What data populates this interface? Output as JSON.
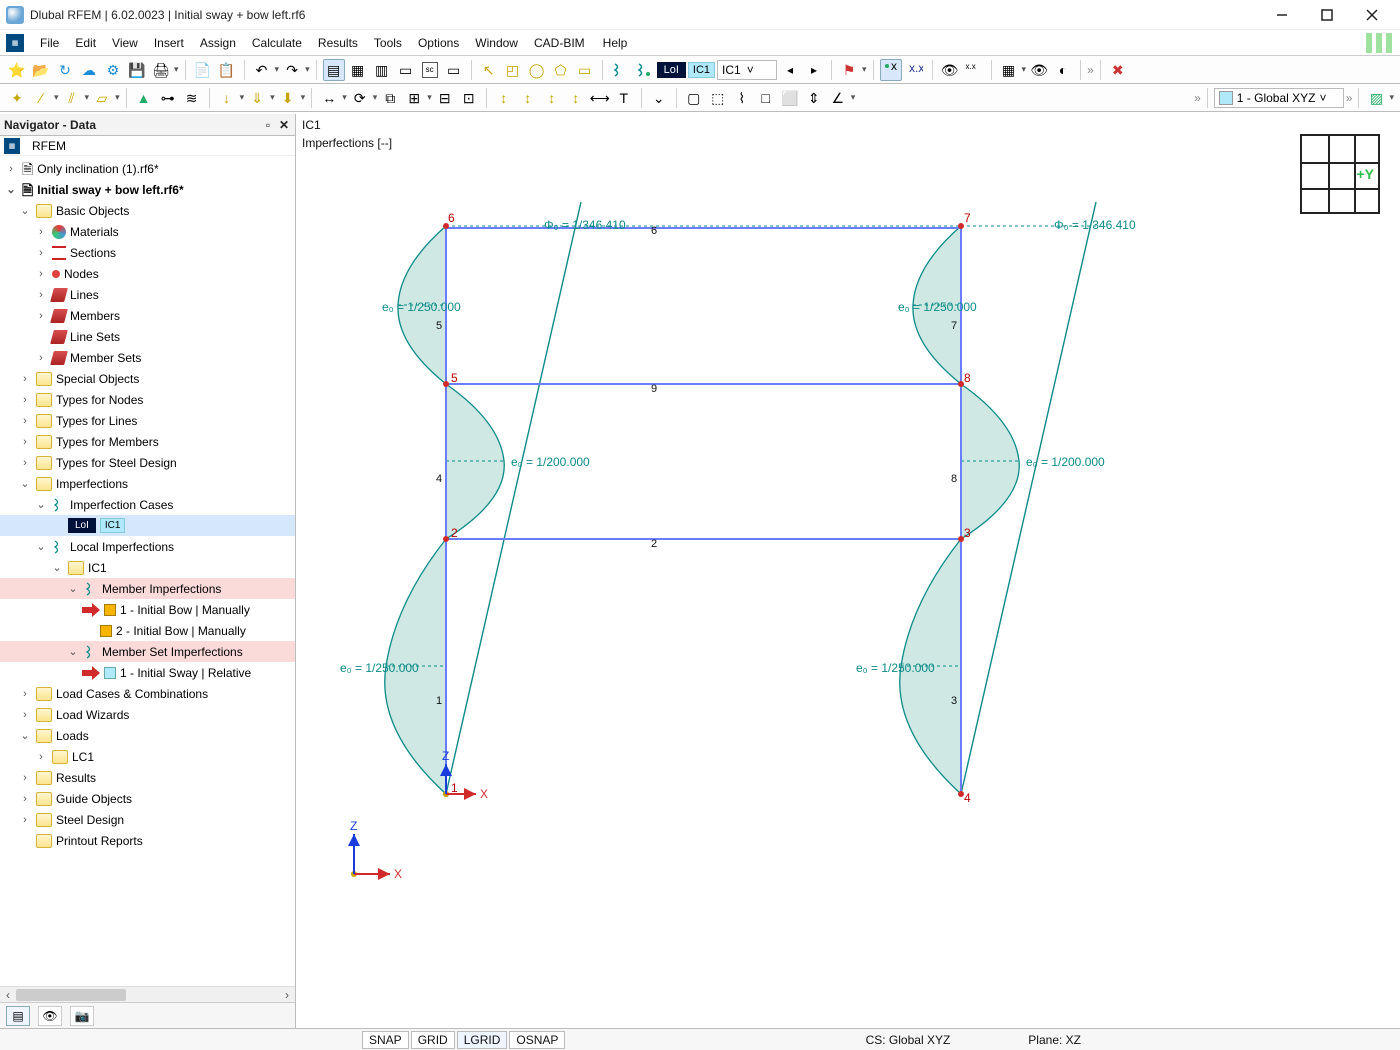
{
  "window": {
    "title": "Dlubal RFEM | 6.02.0023 | Initial sway + bow left.rf6"
  },
  "menu": {
    "items": [
      "File",
      "Edit",
      "View",
      "Insert",
      "Assign",
      "Calculate",
      "Results",
      "Tools",
      "Options",
      "Window",
      "CAD-BIM",
      "Help"
    ]
  },
  "context_labels": {
    "lol": "LoI",
    "ic1": "IC1",
    "global_xyz": "1 - Global XYZ"
  },
  "navigator": {
    "title": "Navigator - Data",
    "app": "RFEM",
    "file1": "Only inclination (1).rf6*",
    "file2": "Initial sway + bow left.rf6*",
    "basic_objects": "Basic Objects",
    "materials": "Materials",
    "sections": "Sections",
    "nodes": "Nodes",
    "lines": "Lines",
    "members": "Members",
    "line_sets": "Line Sets",
    "member_sets": "Member Sets",
    "special_objects": "Special Objects",
    "types_nodes": "Types for Nodes",
    "types_lines": "Types for Lines",
    "types_members": "Types for Members",
    "types_steel": "Types for Steel Design",
    "imperfections": "Imperfections",
    "imp_cases": "Imperfection Cases",
    "lol": "LoI",
    "ic1_sel": "IC1",
    "local_imp": "Local Imperfections",
    "ic1": "IC1",
    "member_imp": "Member Imperfections",
    "mi1": "1 - Initial Bow | Manually",
    "mi2": "2 - Initial Bow | Manually",
    "memberset_imp": "Member Set Imperfections",
    "msi1": "1 - Initial Sway | Relative",
    "lcc": "Load Cases & Combinations",
    "load_wiz": "Load Wizards",
    "loads": "Loads",
    "lc1": "LC1",
    "results": "Results",
    "guide": "Guide Objects",
    "steel": "Steel Design",
    "printout": "Printout Reports"
  },
  "viewport": {
    "label1": "IC1",
    "label2": "Imperfections [--]",
    "phi_top": "Φ₀ =  1/346.410",
    "e250": "e₀ =  1/250.000",
    "e200": "e₀ =  1/200.000",
    "n1": "1",
    "n2": "2",
    "n3": "3",
    "n4": "4",
    "n5": "5",
    "n6": "6",
    "n7": "7",
    "n8": "8",
    "e_top": "6",
    "e_mid": "9",
    "e_low": "2",
    "col_l_bot": "1",
    "col_l_mid": "4",
    "col_l_top": "5",
    "col_r_bot": "3",
    "col_r_mid": "8",
    "col_r_top": "7",
    "ax_x": "X",
    "ax_z": "Z",
    "ax_y": "+Y"
  },
  "status": {
    "snap": "SNAP",
    "grid": "GRID",
    "lgrid": "LGRID",
    "osnap": "OSNAP",
    "cs": "CS: Global XYZ",
    "plane": "Plane: XZ"
  }
}
